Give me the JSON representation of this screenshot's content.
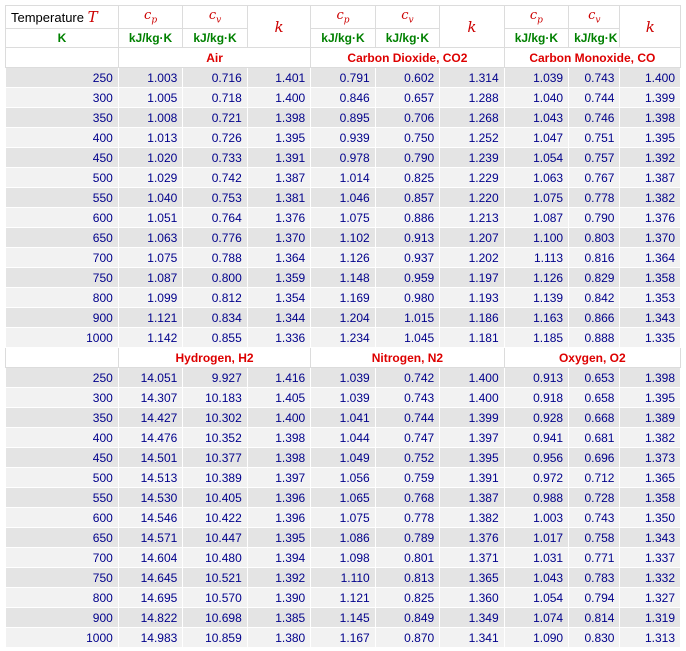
{
  "header": {
    "temperature_label": "Temperature",
    "temperature_symbol": "T",
    "temperature_unit": "K",
    "cp_symbol": "c",
    "cp_sub": "p",
    "cv_symbol": "c",
    "cv_sub": "v",
    "k_symbol": "k",
    "unit": "kJ/kg·K"
  },
  "colors": {
    "heading_red": "#cc0000",
    "unit_green": "#008000",
    "value_navy": "#00008b",
    "row_shade_dark": "#e4e4e4",
    "row_shade_light": "#f2f2f2"
  },
  "sections": [
    {
      "gases": [
        "Air",
        "Carbon Dioxide, CO2",
        "Carbon Monoxide, CO"
      ],
      "rows": [
        [
          "250",
          "1.003",
          "0.716",
          "1.401",
          "0.791",
          "0.602",
          "1.314",
          "1.039",
          "0.743",
          "1.400"
        ],
        [
          "300",
          "1.005",
          "0.718",
          "1.400",
          "0.846",
          "0.657",
          "1.288",
          "1.040",
          "0.744",
          "1.399"
        ],
        [
          "350",
          "1.008",
          "0.721",
          "1.398",
          "0.895",
          "0.706",
          "1.268",
          "1.043",
          "0.746",
          "1.398"
        ],
        [
          "400",
          "1.013",
          "0.726",
          "1.395",
          "0.939",
          "0.750",
          "1.252",
          "1.047",
          "0.751",
          "1.395"
        ],
        [
          "450",
          "1.020",
          "0.733",
          "1.391",
          "0.978",
          "0.790",
          "1.239",
          "1.054",
          "0.757",
          "1.392"
        ],
        [
          "500",
          "1.029",
          "0.742",
          "1.387",
          "1.014",
          "0.825",
          "1.229",
          "1.063",
          "0.767",
          "1.387"
        ],
        [
          "550",
          "1.040",
          "0.753",
          "1.381",
          "1.046",
          "0.857",
          "1.220",
          "1.075",
          "0.778",
          "1.382"
        ],
        [
          "600",
          "1.051",
          "0.764",
          "1.376",
          "1.075",
          "0.886",
          "1.213",
          "1.087",
          "0.790",
          "1.376"
        ],
        [
          "650",
          "1.063",
          "0.776",
          "1.370",
          "1.102",
          "0.913",
          "1.207",
          "1.100",
          "0.803",
          "1.370"
        ],
        [
          "700",
          "1.075",
          "0.788",
          "1.364",
          "1.126",
          "0.937",
          "1.202",
          "1.113",
          "0.816",
          "1.364"
        ],
        [
          "750",
          "1.087",
          "0.800",
          "1.359",
          "1.148",
          "0.959",
          "1.197",
          "1.126",
          "0.829",
          "1.358"
        ],
        [
          "800",
          "1.099",
          "0.812",
          "1.354",
          "1.169",
          "0.980",
          "1.193",
          "1.139",
          "0.842",
          "1.353"
        ],
        [
          "900",
          "1.121",
          "0.834",
          "1.344",
          "1.204",
          "1.015",
          "1.186",
          "1.163",
          "0.866",
          "1.343"
        ],
        [
          "1000",
          "1.142",
          "0.855",
          "1.336",
          "1.234",
          "1.045",
          "1.181",
          "1.185",
          "0.888",
          "1.335"
        ]
      ]
    },
    {
      "gases": [
        "Hydrogen, H2",
        "Nitrogen, N2",
        "Oxygen, O2"
      ],
      "rows": [
        [
          "250",
          "14.051",
          "9.927",
          "1.416",
          "1.039",
          "0.742",
          "1.400",
          "0.913",
          "0.653",
          "1.398"
        ],
        [
          "300",
          "14.307",
          "10.183",
          "1.405",
          "1.039",
          "0.743",
          "1.400",
          "0.918",
          "0.658",
          "1.395"
        ],
        [
          "350",
          "14.427",
          "10.302",
          "1.400",
          "1.041",
          "0.744",
          "1.399",
          "0.928",
          "0.668",
          "1.389"
        ],
        [
          "400",
          "14.476",
          "10.352",
          "1.398",
          "1.044",
          "0.747",
          "1.397",
          "0.941",
          "0.681",
          "1.382"
        ],
        [
          "450",
          "14.501",
          "10.377",
          "1.398",
          "1.049",
          "0.752",
          "1.395",
          "0.956",
          "0.696",
          "1.373"
        ],
        [
          "500",
          "14.513",
          "10.389",
          "1.397",
          "1.056",
          "0.759",
          "1.391",
          "0.972",
          "0.712",
          "1.365"
        ],
        [
          "550",
          "14.530",
          "10.405",
          "1.396",
          "1.065",
          "0.768",
          "1.387",
          "0.988",
          "0.728",
          "1.358"
        ],
        [
          "600",
          "14.546",
          "10.422",
          "1.396",
          "1.075",
          "0.778",
          "1.382",
          "1.003",
          "0.743",
          "1.350"
        ],
        [
          "650",
          "14.571",
          "10.447",
          "1.395",
          "1.086",
          "0.789",
          "1.376",
          "1.017",
          "0.758",
          "1.343"
        ],
        [
          "700",
          "14.604",
          "10.480",
          "1.394",
          "1.098",
          "0.801",
          "1.371",
          "1.031",
          "0.771",
          "1.337"
        ],
        [
          "750",
          "14.645",
          "10.521",
          "1.392",
          "1.110",
          "0.813",
          "1.365",
          "1.043",
          "0.783",
          "1.332"
        ],
        [
          "800",
          "14.695",
          "10.570",
          "1.390",
          "1.121",
          "0.825",
          "1.360",
          "1.054",
          "0.794",
          "1.327"
        ],
        [
          "900",
          "14.822",
          "10.698",
          "1.385",
          "1.145",
          "0.849",
          "1.349",
          "1.074",
          "0.814",
          "1.319"
        ],
        [
          "1000",
          "14.983",
          "10.859",
          "1.380",
          "1.167",
          "0.870",
          "1.341",
          "1.090",
          "0.830",
          "1.313"
        ]
      ]
    }
  ]
}
